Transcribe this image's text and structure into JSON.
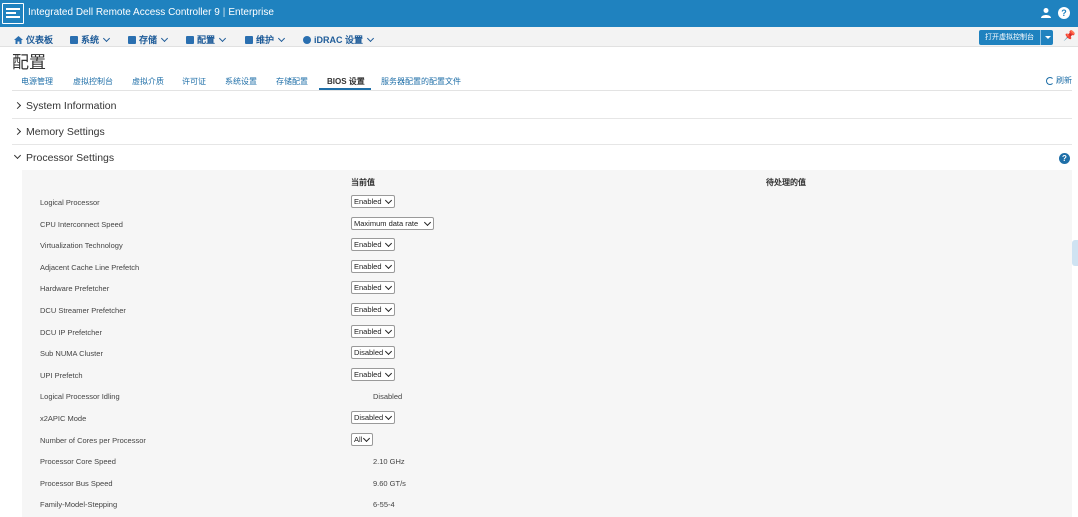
{
  "app": {
    "title": "Integrated Dell Remote Access Controller 9",
    "edition": "Enterprise"
  },
  "nav": {
    "items": [
      {
        "label": "仪表板",
        "icon": "home-icon"
      },
      {
        "label": "系统",
        "icon": "server-icon"
      },
      {
        "label": "存储",
        "icon": "storage-icon"
      },
      {
        "label": "配置",
        "icon": "configuration-icon"
      },
      {
        "label": "维护",
        "icon": "maintenance-icon"
      },
      {
        "label": "iDRAC 设置",
        "icon": "settings-icon"
      }
    ],
    "virtual_console_button": "打开虚拟控制台"
  },
  "page": {
    "title": "配置",
    "refresh_label": "刷新",
    "tabs": [
      "电源管理",
      "虚拟控制台",
      "虚拟介质",
      "许可证",
      "系统设置",
      "存储配置",
      "BIOS 设置",
      "服务器配置的配置文件"
    ],
    "active_tab": "BIOS 设置"
  },
  "sections": [
    {
      "label": "System Information",
      "expanded": false
    },
    {
      "label": "Memory Settings",
      "expanded": false
    },
    {
      "label": "Processor Settings",
      "expanded": true
    }
  ],
  "processor": {
    "current_value_header": "当前值",
    "pending_value_header": "待处理的值",
    "rows": [
      {
        "label": "Logical Processor",
        "value": "Enabled",
        "type": "select"
      },
      {
        "label": "CPU Interconnect Speed",
        "value": "Maximum data rate",
        "type": "select"
      },
      {
        "label": "Virtualization Technology",
        "value": "Enabled",
        "type": "select"
      },
      {
        "label": "Adjacent Cache Line Prefetch",
        "value": "Enabled",
        "type": "select"
      },
      {
        "label": "Hardware Prefetcher",
        "value": "Enabled",
        "type": "select"
      },
      {
        "label": "DCU Streamer Prefetcher",
        "value": "Enabled",
        "type": "select"
      },
      {
        "label": "DCU IP Prefetcher",
        "value": "Enabled",
        "type": "select"
      },
      {
        "label": "Sub NUMA Cluster",
        "value": "Disabled",
        "type": "select"
      },
      {
        "label": "UPI Prefetch",
        "value": "Enabled",
        "type": "select"
      },
      {
        "label": "Logical Processor Idling",
        "value": "Disabled",
        "type": "text"
      },
      {
        "label": "x2APIC Mode",
        "value": "Disabled",
        "type": "select"
      },
      {
        "label": "Number of Cores per Processor",
        "value": "All",
        "type": "select"
      },
      {
        "label": "Processor Core Speed",
        "value": "2.10 GHz",
        "type": "text"
      },
      {
        "label": "Processor Bus Speed",
        "value": "9.60 GT/s",
        "type": "text"
      },
      {
        "label": "Family-Model-Stepping",
        "value": "6-55-4",
        "type": "text"
      }
    ]
  },
  "colors": {
    "header_blue": "#1f82bf",
    "link_blue": "#1f6fa8",
    "panel_gray": "#f6f6f6"
  }
}
